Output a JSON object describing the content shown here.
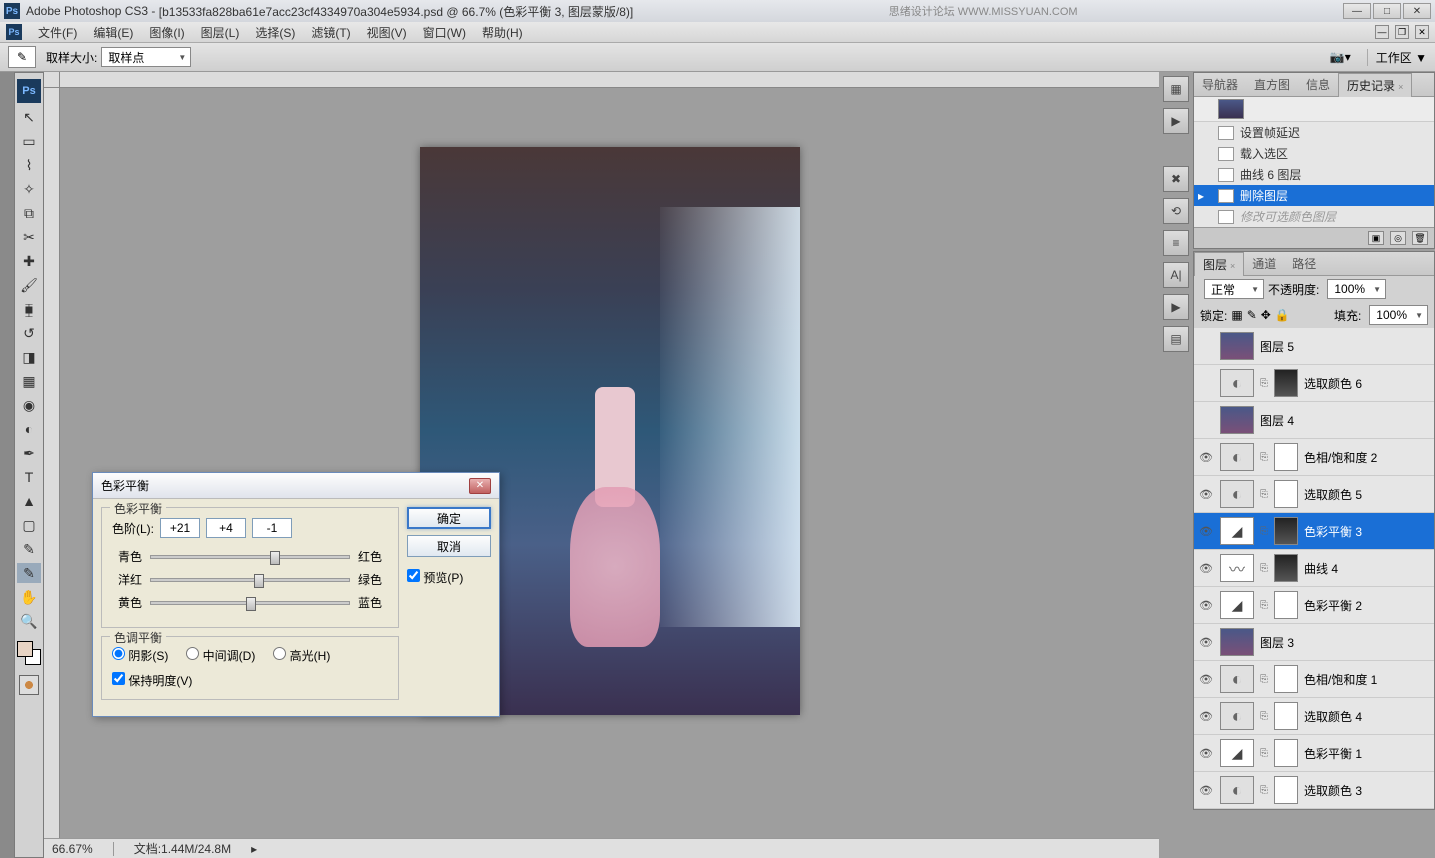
{
  "title_bar": {
    "app": "Adobe Photoshop CS3",
    "doc": "[b13533fa828ba61e7acc23cf4334970a304e5934.psd @ 66.7% (色彩平衡 3, 图层蒙版/8)]",
    "watermark": "思绪设计论坛  WWW.MISSYUAN.COM"
  },
  "menus": [
    "文件(F)",
    "编辑(E)",
    "图像(I)",
    "图层(L)",
    "选择(S)",
    "滤镜(T)",
    "视图(V)",
    "窗口(W)",
    "帮助(H)"
  ],
  "options": {
    "sample_size_label": "取样大小:",
    "sample_size_value": "取样点",
    "workspace_label": "工作区 ▼"
  },
  "history_panel": {
    "tabs": [
      "导航器",
      "直方图",
      "信息",
      "历史记录"
    ],
    "active_tab": 3,
    "items": [
      {
        "label": "设置帧延迟",
        "sel": false
      },
      {
        "label": "载入选区",
        "sel": false
      },
      {
        "label": "曲线 6 图层",
        "sel": false
      },
      {
        "label": "删除图层",
        "sel": true
      },
      {
        "label": "修改可选颜色图层",
        "sel": false,
        "dim": true
      }
    ]
  },
  "layers_panel": {
    "tabs": [
      "图层",
      "通道",
      "路径"
    ],
    "blend_mode": "正常",
    "opacity_label": "不透明度:",
    "opacity": "100%",
    "lock_label": "锁定:",
    "fill_label": "填充:",
    "fill": "100%",
    "layers": [
      {
        "name": "图层 5",
        "vis": false,
        "thumb": "img"
      },
      {
        "name": "选取颜色 6",
        "vis": false,
        "thumb": "adj",
        "mask": "dark"
      },
      {
        "name": "图层 4",
        "vis": false,
        "thumb": "img"
      },
      {
        "name": "色相/饱和度 2",
        "vis": true,
        "thumb": "adj",
        "mask": "white"
      },
      {
        "name": "选取颜色 5",
        "vis": true,
        "thumb": "adj",
        "mask": "white"
      },
      {
        "name": "色彩平衡 3",
        "vis": true,
        "thumb": "levels",
        "mask": "dark",
        "sel": true
      },
      {
        "name": "曲线 4",
        "vis": true,
        "thumb": "curves",
        "mask": "dark"
      },
      {
        "name": "色彩平衡 2",
        "vis": true,
        "thumb": "levels",
        "mask": "white"
      },
      {
        "name": "图层 3",
        "vis": true,
        "thumb": "img"
      },
      {
        "name": "色相/饱和度 1",
        "vis": true,
        "thumb": "adj",
        "mask": "white"
      },
      {
        "name": "选取颜色 4",
        "vis": true,
        "thumb": "adj",
        "mask": "white"
      },
      {
        "name": "色彩平衡 1",
        "vis": true,
        "thumb": "levels",
        "mask": "white"
      },
      {
        "name": "选取颜色 3",
        "vis": true,
        "thumb": "adj",
        "mask": "white"
      }
    ]
  },
  "dialog": {
    "title": "色彩平衡",
    "group1": "色彩平衡",
    "levels_label": "色阶(L):",
    "vals": [
      "+21",
      "+4",
      "-1"
    ],
    "slider_labels": [
      {
        "l": "青色",
        "r": "红色",
        "pos": 60
      },
      {
        "l": "洋红",
        "r": "绿色",
        "pos": 52
      },
      {
        "l": "黄色",
        "r": "蓝色",
        "pos": 48
      }
    ],
    "group2": "色调平衡",
    "tone_options": [
      "阴影(S)",
      "中间调(D)",
      "高光(H)"
    ],
    "tone_selected": 0,
    "preserve_lum": "保持明度(V)",
    "ok": "确定",
    "cancel": "取消",
    "preview": "预览(P)"
  },
  "status": {
    "zoom": "66.67%",
    "doc_label": "文档:",
    "doc_size": "1.44M/24.8M"
  }
}
